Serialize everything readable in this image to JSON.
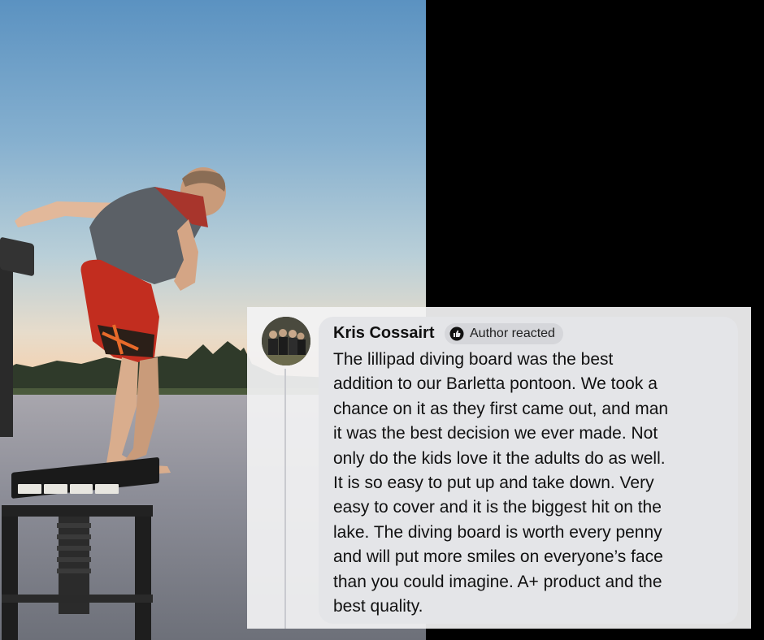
{
  "comment": {
    "author": "Kris Cossairt",
    "badge_label": "Author reacted",
    "badge_icon": "author-reacted-icon",
    "lines": [
      "The lillipad diving board was the best",
      "addition to our Barletta pontoon. We took a",
      "chance on it as they first came out, and man",
      "it was the best decision we ever made. Not",
      "only do the kids love it the adults do as well.",
      "It is so easy to put up and take down. Very",
      "easy to cover and it is the biggest hit on the",
      "lake. The diving board is worth every penny",
      "and will put more smiles on everyone’s face",
      "than you could imagine. A+ product and the",
      "best quality."
    ]
  },
  "colors": {
    "bubble": "#e4e5e8",
    "card": "#f2f2f3",
    "text": "#111111"
  }
}
